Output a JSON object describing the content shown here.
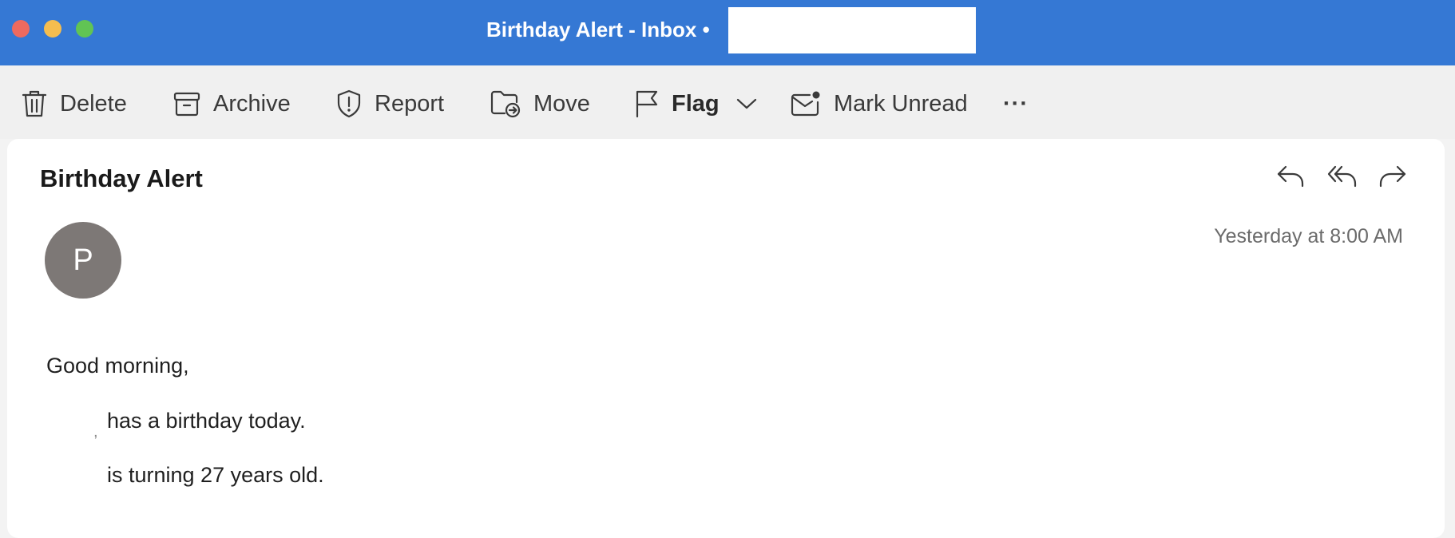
{
  "window": {
    "title": "Birthday Alert - Inbox •"
  },
  "toolbar": {
    "delete_label": "Delete",
    "archive_label": "Archive",
    "report_label": "Report",
    "move_label": "Move",
    "flag_label": "Flag",
    "mark_unread_label": "Mark Unread",
    "more_label": "···"
  },
  "message": {
    "subject": "Birthday Alert",
    "avatar_initial": "P",
    "timestamp": "Yesterday at 8:00 AM",
    "body": {
      "greeting": "Good morning,",
      "line1": "has a birthday today.",
      "line2": "is turning 27 years old."
    }
  },
  "icons": {
    "delete": "trash-icon",
    "archive": "archive-box-icon",
    "report": "shield-alert-icon",
    "move": "folder-move-icon",
    "flag": "flag-icon",
    "flag_dropdown": "chevron-down-icon",
    "mark_unread": "envelope-dot-icon",
    "reply": "reply-icon",
    "reply_all": "reply-all-icon",
    "forward": "forward-icon"
  },
  "colors": {
    "titlebar": "#3578d4",
    "close": "#ee6a5f",
    "minimize": "#f5bd4f",
    "maximize": "#61c454",
    "avatar": "#7d7876"
  }
}
